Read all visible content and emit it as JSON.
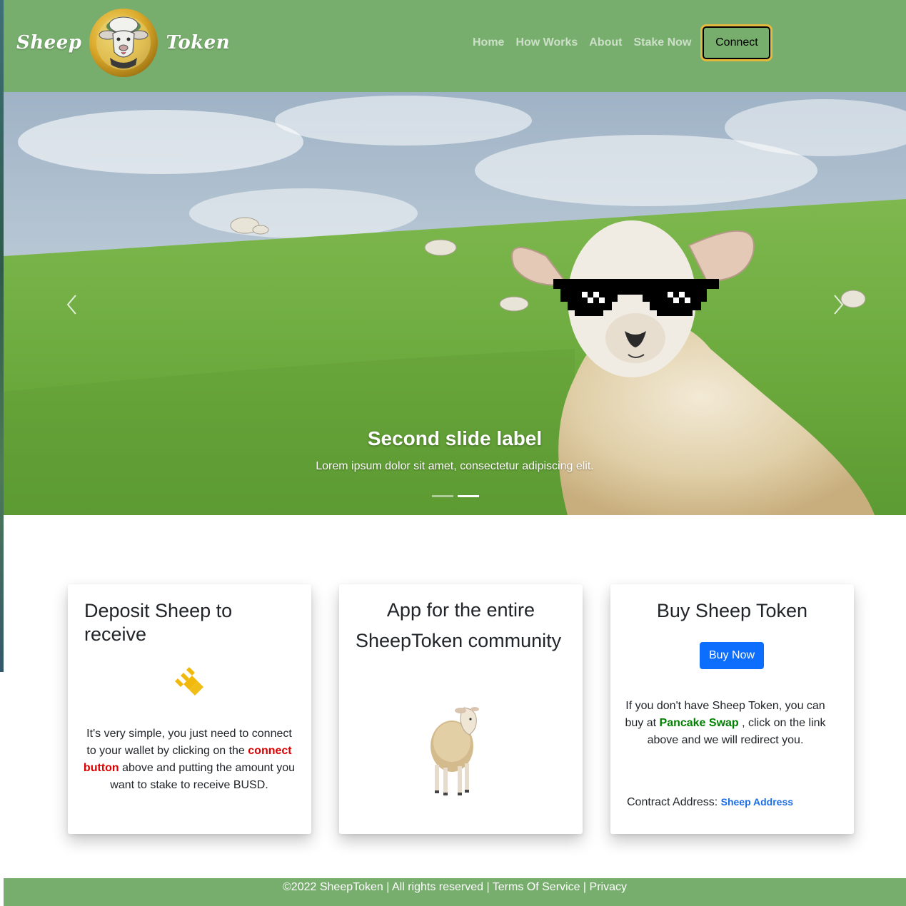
{
  "navbar": {
    "brand_left": "Sheep",
    "brand_right": "Token",
    "links": [
      "Home",
      "How Works",
      "About",
      "Stake Now"
    ],
    "connect_label": "Connect"
  },
  "hero": {
    "slide_title": "Second slide label",
    "slide_text": "Lorem ipsum dolor sit amet, consectetur adipiscing elit.",
    "slides_count": 2,
    "active_slide": 2
  },
  "cards": {
    "deposit": {
      "title": "Deposit Sheep to receive",
      "icon": "busd-icon",
      "text_before": "It's very simple, you just need to connect to your wallet by clicking on the ",
      "link": "connect button",
      "text_after": " above and putting the amount you want to stake to receive BUSD."
    },
    "app": {
      "title_line1": "App for the entire",
      "title_line2": "SheepToken community"
    },
    "buy": {
      "title": "Buy Sheep Token",
      "button": "Buy Now",
      "text_before": "If you don't have Sheep Token, you can buy at ",
      "link": "Pancake Swap",
      "text_after": " , click on the link above and we will redirect you.",
      "contract_label": "Contract Address: ",
      "contract_link": "Sheep Address"
    }
  },
  "footer": {
    "copyright": "©2022 SheepToken | All rights reserved | ",
    "terms": "Terms Of Service",
    "sep": " | ",
    "privacy": "Privacy"
  },
  "colors": {
    "nav_green": "#77ad6d",
    "gold": "#e5b940",
    "buy_blue": "#0d6efd",
    "connect_red": "#e00000",
    "pancake_green": "#008000"
  }
}
